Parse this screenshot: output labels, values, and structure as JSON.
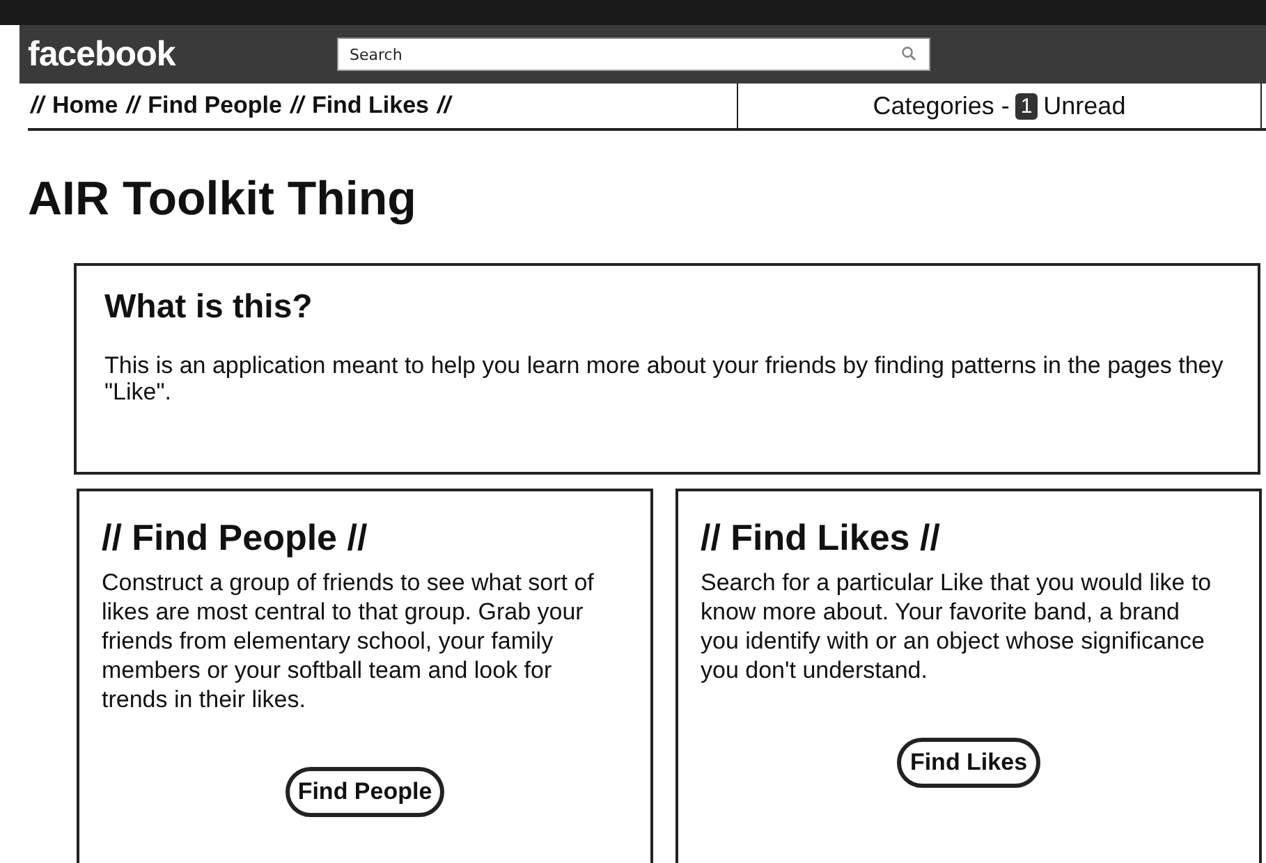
{
  "header": {
    "logo": "facebook",
    "search": {
      "placeholder": "Search"
    }
  },
  "nav": {
    "separators": [
      "//",
      "//",
      "//",
      "//"
    ],
    "links": [
      {
        "label": "Home"
      },
      {
        "label": "Find People"
      },
      {
        "label": "Find Likes"
      }
    ],
    "categories": {
      "label": "Categories -",
      "count": "1",
      "suffix": "Unread"
    }
  },
  "page_title": "AIR Toolkit Thing",
  "intro": {
    "heading": "What is this?",
    "text": "This is an application meant to help you learn more about your friends by finding patterns in the pages they \"Like\"."
  },
  "cards": [
    {
      "heading": "// Find People //",
      "text": "Construct a group of friends to see what sort of likes are most central to that group. Grab your friends from elementary school, your family members or your softball team and look for trends in their likes.",
      "button": "Find People"
    },
    {
      "heading": "// Find Likes //",
      "text": "Search for a particular Like that you would like to know more about. Your favorite band, a brand you identify with or an object whose significance you don't understand.",
      "button": "Find Likes"
    }
  ]
}
